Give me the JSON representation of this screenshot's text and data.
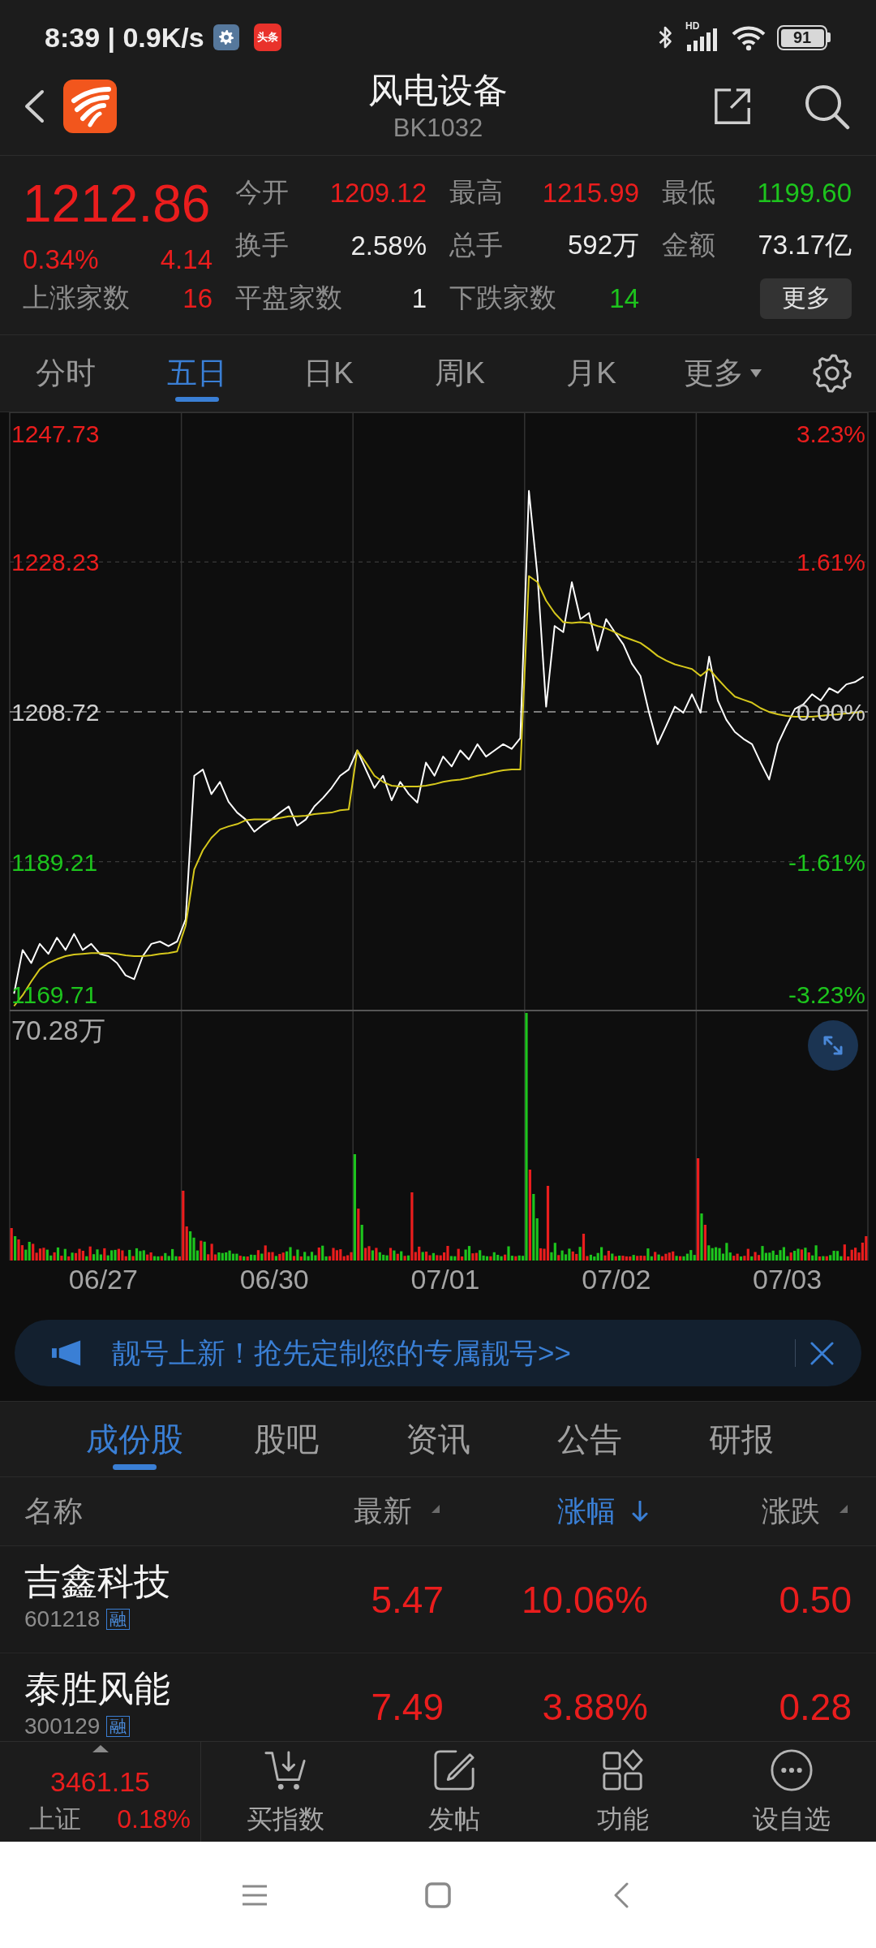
{
  "status_bar": {
    "time": "8:39 | 0.9K/s",
    "news_badge": "头条",
    "network": "HD",
    "battery": "91"
  },
  "header": {
    "title": "风电设备",
    "code": "BK1032"
  },
  "quote": {
    "price": "1212.86",
    "change_pct": "0.34%",
    "change": "4.14",
    "color": "#ea1d1d",
    "stats": [
      {
        "label": "今开",
        "value": "1209.12",
        "color": "#ea1d1d"
      },
      {
        "label": "最高",
        "value": "1215.99",
        "color": "#ea1d1d"
      },
      {
        "label": "最低",
        "value": "1199.60",
        "color": "#1dc41d"
      },
      {
        "label": "换手",
        "value": "2.58%",
        "color": "#ececec"
      },
      {
        "label": "总手",
        "value": "592万",
        "color": "#ececec"
      },
      {
        "label": "金额",
        "value": "73.17亿",
        "color": "#ececec"
      },
      {
        "label": "上涨家数",
        "value": "16",
        "color": "#ea1d1d"
      },
      {
        "label": "平盘家数",
        "value": "1",
        "color": "#ececec"
      },
      {
        "label": "下跌家数",
        "value": "14",
        "color": "#1dc41d"
      }
    ],
    "more_button": "更多"
  },
  "chart_tabs": [
    {
      "label": "分时",
      "selected": false,
      "kind": "tab"
    },
    {
      "label": "五日",
      "selected": true,
      "kind": "tab"
    },
    {
      "label": "日K",
      "selected": false,
      "kind": "tab"
    },
    {
      "label": "周K",
      "selected": false,
      "kind": "tab"
    },
    {
      "label": "月K",
      "selected": false,
      "kind": "tab"
    },
    {
      "label": "更多",
      "selected": false,
      "kind": "dropdown"
    }
  ],
  "chart": {
    "chart_data": {
      "type": "line",
      "ylim": [
        1169.71,
        1247.73
      ],
      "yticks": [
        {
          "value": 1228.23,
          "label": "1228.23"
        },
        {
          "value": 1208.72,
          "label": "1208.72"
        },
        {
          "value": 1189.21,
          "label": "1189.21"
        }
      ],
      "categories": [
        null,
        null,
        null,
        null,
        null,
        null,
        null,
        null,
        null,
        null,
        null,
        null,
        null,
        null,
        null,
        null,
        null,
        null,
        null,
        null,
        null,
        null,
        null,
        null,
        null,
        null,
        null,
        null,
        null,
        null,
        null,
        null,
        null,
        null,
        null,
        null,
        null,
        null,
        null,
        null,
        null,
        null,
        null,
        null,
        null,
        null,
        null,
        null,
        null,
        null,
        null,
        null,
        null,
        null,
        null,
        null,
        null,
        null,
        null,
        null,
        null,
        null,
        null,
        null,
        null,
        null,
        null,
        null,
        null,
        null,
        null,
        null,
        null,
        null,
        null,
        null,
        null,
        null,
        null,
        null,
        null,
        null,
        null,
        null,
        null,
        null,
        null,
        null,
        null,
        null,
        null,
        null,
        null,
        null,
        null,
        null,
        null,
        null,
        null,
        null
      ],
      "series": [
        {
          "color": "#ffffff",
          "values": [
            1172.0,
            1177.7,
            1176.0,
            1178.5,
            1177.2,
            1179.3,
            1177.7,
            1179.8,
            1177.7,
            1178.5,
            1177.2,
            1176.9,
            1176.0,
            1174.4,
            1173.9,
            1176.9,
            1178.5,
            1178.8,
            1178.2,
            1178.8,
            1181.7,
            1200.4,
            1201.2,
            1198.0,
            1199.6,
            1197.0,
            1195.6,
            1194.7,
            1193.1,
            1194.0,
            1194.7,
            1195.6,
            1196.4,
            1193.9,
            1194.7,
            1196.4,
            1197.5,
            1198.8,
            1200.4,
            1201.2,
            1203.7,
            1201.2,
            1198.8,
            1200.4,
            1197.2,
            1199.6,
            1198.0,
            1196.9,
            1202.1,
            1200.4,
            1202.9,
            1201.6,
            1203.7,
            1202.5,
            1204.5,
            1202.9,
            1203.7,
            1204.5,
            1203.9,
            1205.3,
            1237.5,
            1226.4,
            1209.4,
            1219.9,
            1219.1,
            1225.6,
            1220.8,
            1221.6,
            1216.7,
            1220.8,
            1219.1,
            1217.5,
            1215.0,
            1213.4,
            1208.6,
            1204.5,
            1206.9,
            1209.4,
            1208.6,
            1211.0,
            1208.6,
            1215.9,
            1210.2,
            1207.7,
            1206.1,
            1205.2,
            1204.5,
            1202.1,
            1199.9,
            1204.5,
            1206.9,
            1209.1,
            1209.7,
            1211.0,
            1210.2,
            1211.8,
            1211.2,
            1212.3,
            1212.6,
            1213.3
          ]
        },
        {
          "color": "#d6c81c",
          "values": [
            1170.4,
            1171.8,
            1173.6,
            1175.2,
            1176.0,
            1176.5,
            1176.9,
            1177.1,
            1177.2,
            1177.3,
            1177.3,
            1177.3,
            1177.2,
            1177.0,
            1176.9,
            1176.9,
            1177.0,
            1177.2,
            1177.3,
            1177.5,
            1180.9,
            1188.2,
            1190.7,
            1192.3,
            1193.4,
            1193.8,
            1194.1,
            1194.6,
            1194.7,
            1194.7,
            1194.7,
            1194.9,
            1195.1,
            1195.1,
            1195.2,
            1195.4,
            1195.5,
            1195.6,
            1195.9,
            1196.0,
            1203.7,
            1202.1,
            1200.4,
            1199.6,
            1199.1,
            1199.0,
            1199.0,
            1199.0,
            1199.1,
            1199.3,
            1199.6,
            1199.8,
            1199.9,
            1200.1,
            1200.4,
            1200.6,
            1200.9,
            1201.1,
            1201.2,
            1201.2,
            1226.4,
            1225.6,
            1223.2,
            1221.6,
            1220.4,
            1220.3,
            1220.4,
            1220.3,
            1219.9,
            1219.6,
            1219.1,
            1218.5,
            1218.1,
            1217.7,
            1216.9,
            1216.0,
            1215.4,
            1214.9,
            1214.6,
            1214.3,
            1213.4,
            1214.3,
            1213.0,
            1211.8,
            1210.7,
            1210.3,
            1209.9,
            1209.2,
            1208.7,
            1208.4,
            1208.2,
            1208.1,
            1208.1,
            1208.1,
            1208.2,
            1208.3,
            1208.4,
            1208.5,
            1208.6,
            1208.7
          ]
        }
      ],
      "ref_lines": [
        {
          "axis": "y",
          "value": 1208.72
        }
      ]
    },
    "range_labels": {
      "max": "1247.73",
      "max_pct": "3.23%",
      "min": "1169.71",
      "min_pct": "-3.23%"
    },
    "percent_ticks": [
      "1.61%",
      "0.00%",
      "-1.61%"
    ],
    "dates": [
      "06/27",
      "06/30",
      "07/01",
      "07/02",
      "07/03"
    ]
  },
  "volume": {
    "max_label": "70.28万"
  },
  "banner": {
    "text": "靓号上新！抢先定制您的专属靓号>>"
  },
  "sub_tabs": [
    {
      "label": "成份股",
      "selected": true
    },
    {
      "label": "股吧",
      "selected": false
    },
    {
      "label": "资讯",
      "selected": false
    },
    {
      "label": "公告",
      "selected": false
    },
    {
      "label": "研报",
      "selected": false
    }
  ],
  "table": {
    "columns": [
      {
        "label": "名称",
        "kind": "plain",
        "selected": false
      },
      {
        "label": "最新",
        "kind": "sortable",
        "selected": false
      },
      {
        "label": "涨幅",
        "kind": "sortable",
        "selected": true
      },
      {
        "label": "涨跌",
        "kind": "sortable",
        "selected": false
      }
    ],
    "rows": [
      {
        "name": "吉鑫科技",
        "code": "601218",
        "badge": "融",
        "price": "5.47",
        "change_pct": "10.06%",
        "change": "0.50",
        "color": "#ea1d1d"
      },
      {
        "name": "泰胜风能",
        "code": "300129",
        "badge": "融",
        "price": "7.49",
        "change_pct": "3.88%",
        "change": "0.28",
        "color": "#ea1d1d"
      }
    ]
  },
  "bottom_nav": {
    "index": {
      "value": "3461.15",
      "name": "上证",
      "change_pct": "0.18%",
      "color": "#ea1d1d"
    },
    "items": [
      {
        "label": "买指数",
        "kind": "cart"
      },
      {
        "label": "发帖",
        "kind": "compose"
      },
      {
        "label": "功能",
        "kind": "grid"
      },
      {
        "label": "设自选",
        "kind": "more"
      }
    ]
  }
}
